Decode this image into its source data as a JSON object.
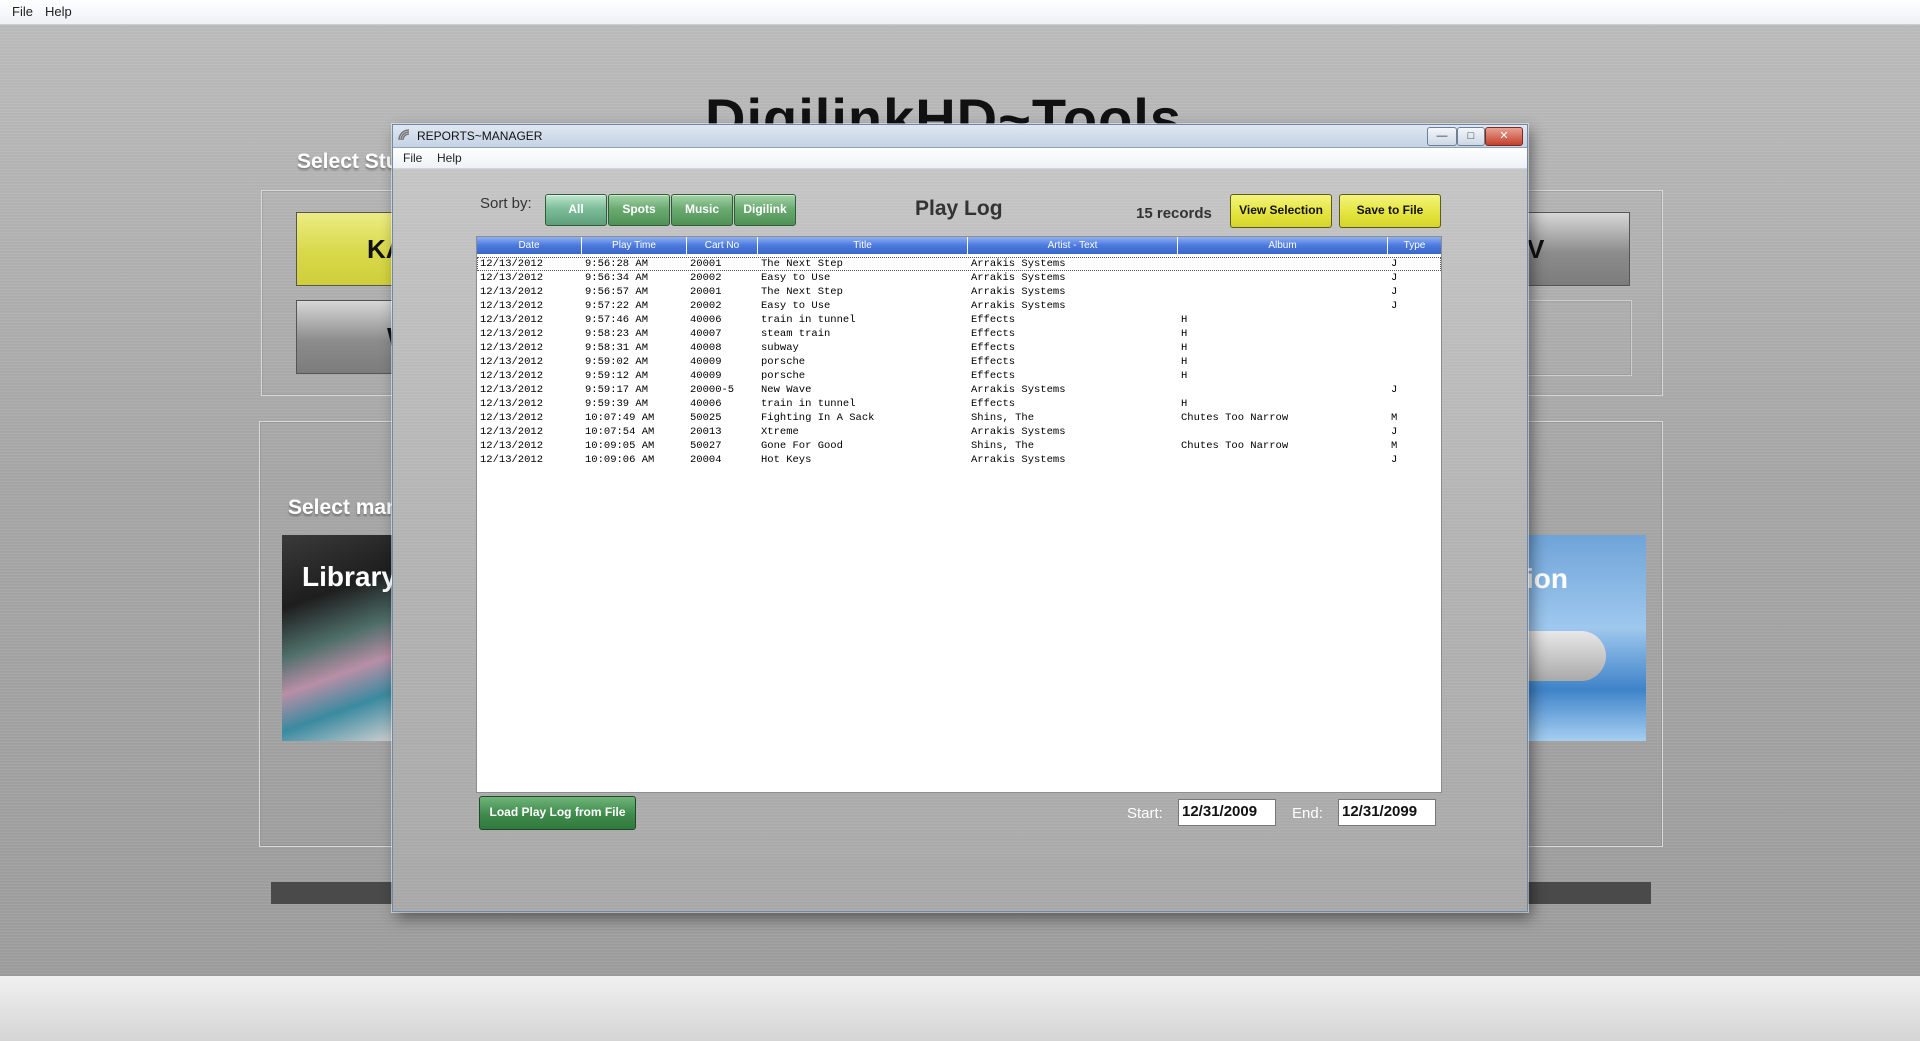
{
  "main_menu": [
    "File",
    "Help"
  ],
  "background": {
    "app_title": "DigilinkHD~Tools",
    "studio_label": "Select Stu",
    "studio_buttons": [
      "KA",
      "W",
      "V"
    ],
    "manage_label": "Select man",
    "tiles": [
      "Library",
      "ion"
    ]
  },
  "window": {
    "title": "REPORTS~MANAGER",
    "menu": [
      "File",
      "Help"
    ],
    "controls": [
      "—",
      "□",
      "✕"
    ]
  },
  "toolbar": {
    "sort_label": "Sort by:",
    "sort_buttons": [
      "All",
      "Spots",
      "Music",
      "Digilink"
    ],
    "heading": "Play Log",
    "records": "15 records",
    "view_selection": "View Selection",
    "save_to_file": "Save to File"
  },
  "grid": {
    "columns": [
      "Date",
      "Play Time",
      "Cart No",
      "Title",
      "Artist - Text",
      "Album",
      "Type"
    ],
    "rows": [
      [
        "12/13/2012",
        "9:56:28 AM",
        "20001",
        "The Next Step",
        "Arrakis Systems",
        "",
        "J"
      ],
      [
        "12/13/2012",
        "9:56:34 AM",
        "20002",
        "Easy to Use",
        "Arrakis Systems",
        "",
        "J"
      ],
      [
        "12/13/2012",
        "9:56:57 AM",
        "20001",
        "The Next Step",
        "Arrakis Systems",
        "",
        "J"
      ],
      [
        "12/13/2012",
        "9:57:22 AM",
        "20002",
        "Easy to Use",
        "Arrakis Systems",
        "",
        "J"
      ],
      [
        "12/13/2012",
        "9:57:46 AM",
        "40006",
        "train in tunnel",
        "Effects",
        "H",
        ""
      ],
      [
        "12/13/2012",
        "9:58:23 AM",
        "40007",
        "steam train",
        "Effects",
        "H",
        ""
      ],
      [
        "12/13/2012",
        "9:58:31 AM",
        "40008",
        "subway",
        "Effects",
        "H",
        ""
      ],
      [
        "12/13/2012",
        "9:59:02 AM",
        "40009",
        "porsche",
        "Effects",
        "H",
        ""
      ],
      [
        "12/13/2012",
        "9:59:12 AM",
        "40009",
        "porsche",
        "Effects",
        "H",
        ""
      ],
      [
        "12/13/2012",
        "9:59:17 AM",
        "20000-5",
        "New Wave",
        "Arrakis Systems",
        "",
        "J"
      ],
      [
        "12/13/2012",
        "9:59:39 AM",
        "40006",
        "train in tunnel",
        "Effects",
        "H",
        ""
      ],
      [
        "12/13/2012",
        "10:07:49 AM",
        "50025",
        "Fighting In A Sack",
        "Shins, The",
        "Chutes Too Narrow",
        "M"
      ],
      [
        "12/13/2012",
        "10:07:54 AM",
        "20013",
        "Xtreme",
        "Arrakis Systems",
        "",
        "J"
      ],
      [
        "12/13/2012",
        "10:09:05 AM",
        "50027",
        "Gone For Good",
        "Shins, The",
        "Chutes Too Narrow",
        "M"
      ],
      [
        "12/13/2012",
        "10:09:06 AM",
        "20004",
        "Hot Keys",
        "Arrakis Systems",
        "",
        "J"
      ]
    ]
  },
  "footer": {
    "load_button": "Load Play Log from File",
    "start_label": "Start:",
    "start_value": "12/31/2009",
    "end_label": "End:",
    "end_value": "12/31/2099"
  },
  "colors": {
    "header_blue": "#4b79dd",
    "sort_green": "#6cab72",
    "action_yellow": "#e3e33c",
    "load_green": "#3f8a4c"
  }
}
